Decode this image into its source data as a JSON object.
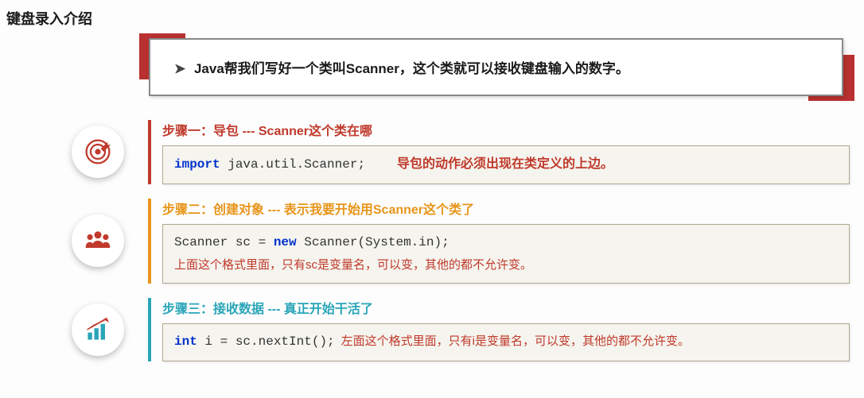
{
  "title": "键盘录入介绍",
  "intro": "Java帮我们写好一个类叫Scanner，这个类就可以接收键盘输入的数字。",
  "steps": {
    "s1": {
      "title": "步骤一：导包  ---  Scanner这个类在哪",
      "kw": "import",
      "code": " java.util.Scanner;",
      "note": "导包的动作必须出现在类定义的上边。"
    },
    "s2": {
      "title": "步骤二：创建对象 --- 表示我要开始用Scanner这个类了",
      "code_pre": "Scanner sc = ",
      "kw": "new",
      "code_post": " Scanner(System.in);",
      "note": "上面这个格式里面，只有sc是变量名，可以变，其他的都不允许变。"
    },
    "s3": {
      "title": "步骤三：接收数据 --- 真正开始干活了",
      "kw": "int",
      "code": " i = sc.nextInt();",
      "note": "左面这个格式里面，只有i是变量名，可以变，其他的都不允许变。"
    }
  }
}
